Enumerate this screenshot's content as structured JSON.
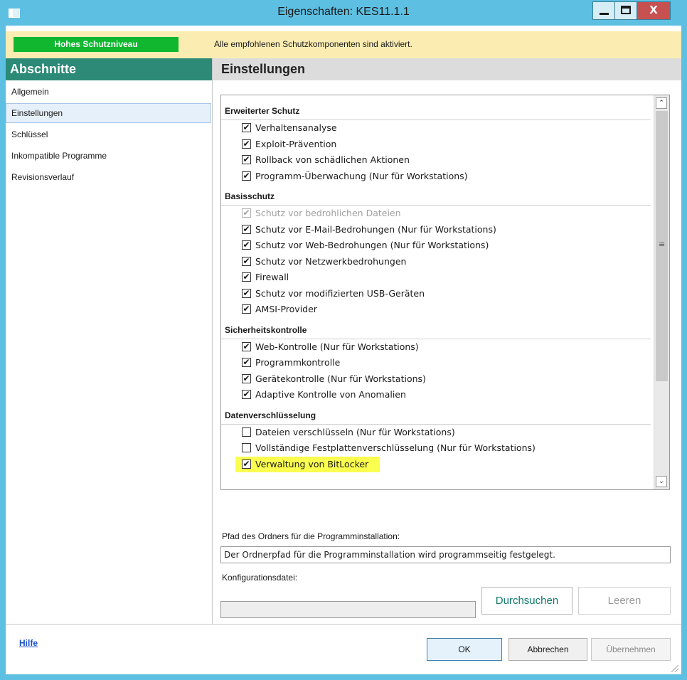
{
  "window": {
    "title": "Eigenschaften: KES11.1.1",
    "close_glyph": "X"
  },
  "status": {
    "level": "Hohes Schutzniveau",
    "message": "Alle empfohlenen Schutzkomponenten sind aktiviert.",
    "level_color": "#10b72f",
    "banner_color": "#fbecb2"
  },
  "sidebar": {
    "heading": "Abschnitte",
    "heading_color": "#2c8a76",
    "items": [
      {
        "label": "Allgemein",
        "active": false
      },
      {
        "label": "Einstellungen",
        "active": true
      },
      {
        "label": "Schlüssel",
        "active": false
      },
      {
        "label": "Inkompatible Programme",
        "active": false
      },
      {
        "label": "Revisionsverlauf",
        "active": false
      }
    ]
  },
  "main": {
    "heading": "Einstellungen",
    "sections": [
      {
        "title": "Erweiterter Schutz",
        "options": [
          {
            "label": "Verhaltensanalyse",
            "checked": true
          },
          {
            "label": "Exploit-Prävention",
            "checked": true
          },
          {
            "label": "Rollback von schädlichen Aktionen",
            "checked": true
          },
          {
            "label": "Programm-Überwachung (Nur für Workstations)",
            "checked": true
          }
        ]
      },
      {
        "title": "Basisschutz",
        "options": [
          {
            "label": "Schutz vor bedrohlichen Dateien",
            "checked": true,
            "disabled": true
          },
          {
            "label": "Schutz vor E-Mail-Bedrohungen (Nur für Workstations)",
            "checked": true
          },
          {
            "label": "Schutz vor Web-Bedrohungen (Nur für Workstations)",
            "checked": true
          },
          {
            "label": "Schutz vor Netzwerkbedrohungen",
            "checked": true
          },
          {
            "label": "Firewall",
            "checked": true
          },
          {
            "label": "Schutz vor modifizierten USB-Geräten",
            "checked": true
          },
          {
            "label": "AMSI-Provider",
            "checked": true
          }
        ]
      },
      {
        "title": "Sicherheitskontrolle",
        "options": [
          {
            "label": "Web-Kontrolle (Nur für Workstations)",
            "checked": true
          },
          {
            "label": "Programmkontrolle",
            "checked": true
          },
          {
            "label": "Gerätekontrolle (Nur für Workstations)",
            "checked": true
          },
          {
            "label": "Adaptive Kontrolle von Anomalien",
            "checked": true
          }
        ]
      },
      {
        "title": "Datenverschlüsselung",
        "options": [
          {
            "label": "Dateien verschlüsseln (Nur für Workstations)",
            "checked": false
          },
          {
            "label": "Vollständige Festplattenverschlüsselung (Nur für Workstations)",
            "checked": false
          },
          {
            "label": "Verwaltung von BitLocker",
            "checked": true,
            "highlighted": true
          }
        ]
      }
    ],
    "install_path_label": "Pfad des Ordners für die Programminstallation:",
    "install_path_value": "Der Ordnerpfad für die Programminstallation wird programmseitig festgelegt.",
    "config_label": "Konfigurationsdatei:",
    "config_value": "",
    "browse_label": "Durchsuchen",
    "clear_label": "Leeren",
    "highlight_color": "#fbff4e"
  },
  "footer": {
    "help": "Hilfe",
    "ok": "OK",
    "cancel": "Abbrechen",
    "apply": "Übernehmen"
  },
  "icons": {
    "check": "✔",
    "scroll_up": "⌃",
    "scroll_down": "⌄",
    "scroll_grip": "≡"
  }
}
